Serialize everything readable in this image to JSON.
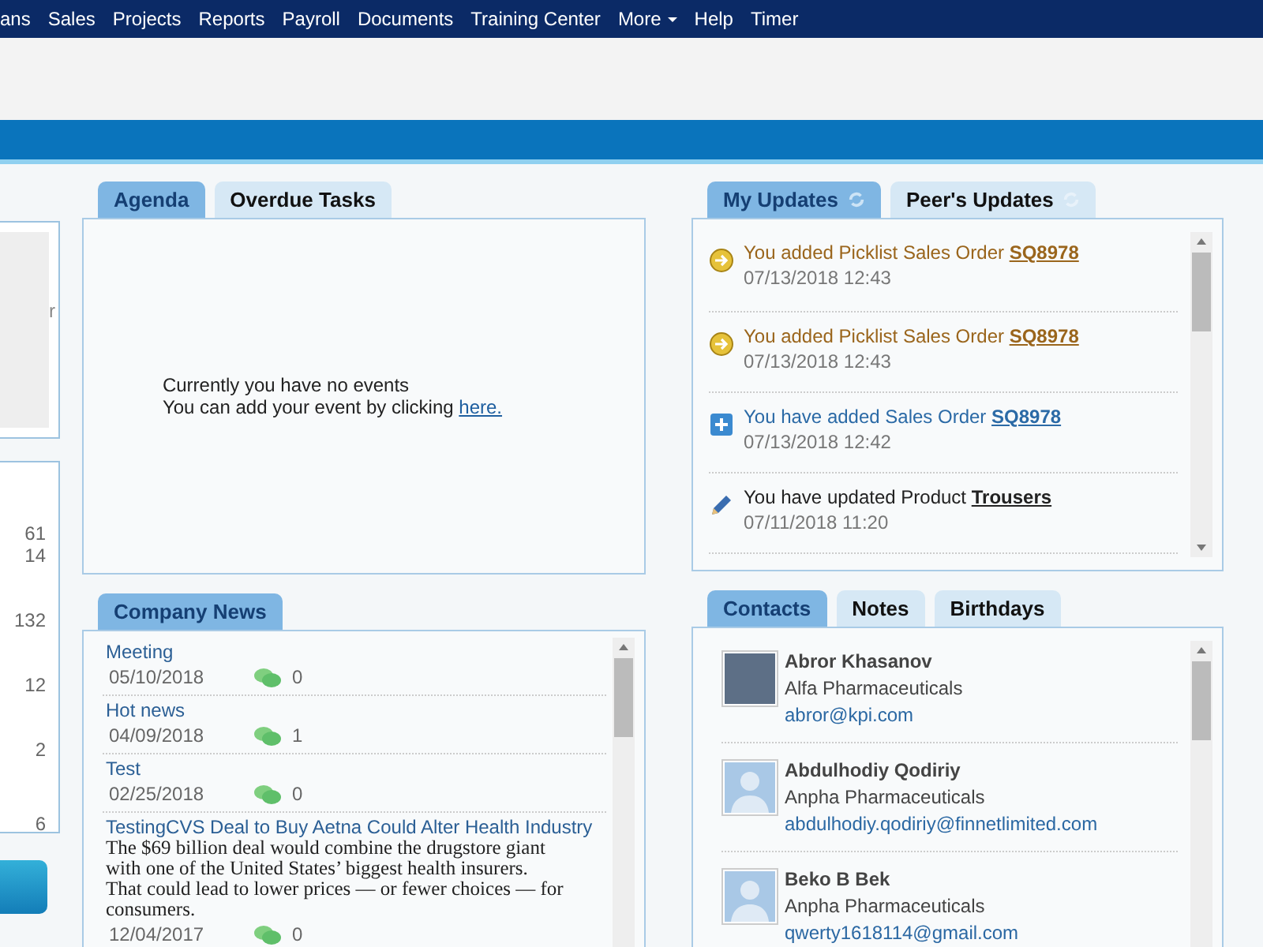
{
  "nav": [
    {
      "label": "ans",
      "dropdown": false
    },
    {
      "label": "Sales",
      "dropdown": false
    },
    {
      "label": "Projects",
      "dropdown": false
    },
    {
      "label": "Reports",
      "dropdown": false
    },
    {
      "label": "Payroll",
      "dropdown": false
    },
    {
      "label": "Documents",
      "dropdown": false
    },
    {
      "label": "Training Center",
      "dropdown": false
    },
    {
      "label": "More",
      "dropdown": true
    },
    {
      "label": "Help",
      "dropdown": false
    },
    {
      "label": "Timer",
      "dropdown": false
    }
  ],
  "sidebar": {
    "fragment": "r",
    "counts": [
      "61",
      "14",
      "132",
      "12",
      "2",
      "6"
    ]
  },
  "agenda": {
    "tabs": [
      {
        "label": "Agenda",
        "selected": true
      },
      {
        "label": "Overdue Tasks",
        "selected": false
      }
    ],
    "empty_line": "Currently you have no events",
    "add_text": "You can add your event by clicking",
    "add_link": "here."
  },
  "updates": {
    "tabs": [
      {
        "label": "My Updates",
        "selected": true
      },
      {
        "label": "Peer's Updates",
        "selected": false
      }
    ],
    "items": [
      {
        "kind": "picklist",
        "text": "You added Picklist Sales Order",
        "link": "SQ8978",
        "time": "07/13/2018 12:43"
      },
      {
        "kind": "picklist",
        "text": "You added Picklist Sales Order",
        "link": "SQ8978",
        "time": "07/13/2018 12:43"
      },
      {
        "kind": "added",
        "text": "You have added Sales Order",
        "link": "SQ8978",
        "time": "07/13/2018 12:42"
      },
      {
        "kind": "updated",
        "text": "You have updated Product",
        "link": "Trousers",
        "time": "07/11/2018 11:20"
      }
    ]
  },
  "news": {
    "tabs": [
      {
        "label": "Company News",
        "selected": true
      }
    ],
    "items": [
      {
        "title": "Meeting",
        "date": "05/10/2018",
        "comments": "0"
      },
      {
        "title": "Hot news",
        "date": "04/09/2018",
        "comments": "1"
      },
      {
        "title": "Test",
        "date": "02/25/2018",
        "comments": "0"
      },
      {
        "title": "TestingCVS Deal to Buy Aetna Could Alter Health Industry",
        "summary": "The $69 billion deal would combine the drugstore giant with one of the United States’ biggest health insurers. That could lead to lower prices — or fewer choices — for consumers.",
        "date": "12/04/2017",
        "comments": "0"
      }
    ]
  },
  "contacts": {
    "tabs": [
      {
        "label": "Contacts",
        "selected": true
      },
      {
        "label": "Notes",
        "selected": false
      },
      {
        "label": "Birthdays",
        "selected": false
      }
    ],
    "items": [
      {
        "kind": "photo",
        "name": "Abror Khasanov",
        "company": "Alfa Pharmaceuticals",
        "email": "abror@kpi.com"
      },
      {
        "kind": "silhouette",
        "name": "Abdulhodiy Qodiriy",
        "company": "Anpha Pharmaceuticals",
        "email": "abdulhodiy.qodiriy@finnetlimited.com"
      },
      {
        "kind": "silhouette",
        "name": "Beko B Bek",
        "company": "Anpha Pharmaceuticals",
        "email": "qwerty1618114@gmail.com"
      }
    ]
  }
}
